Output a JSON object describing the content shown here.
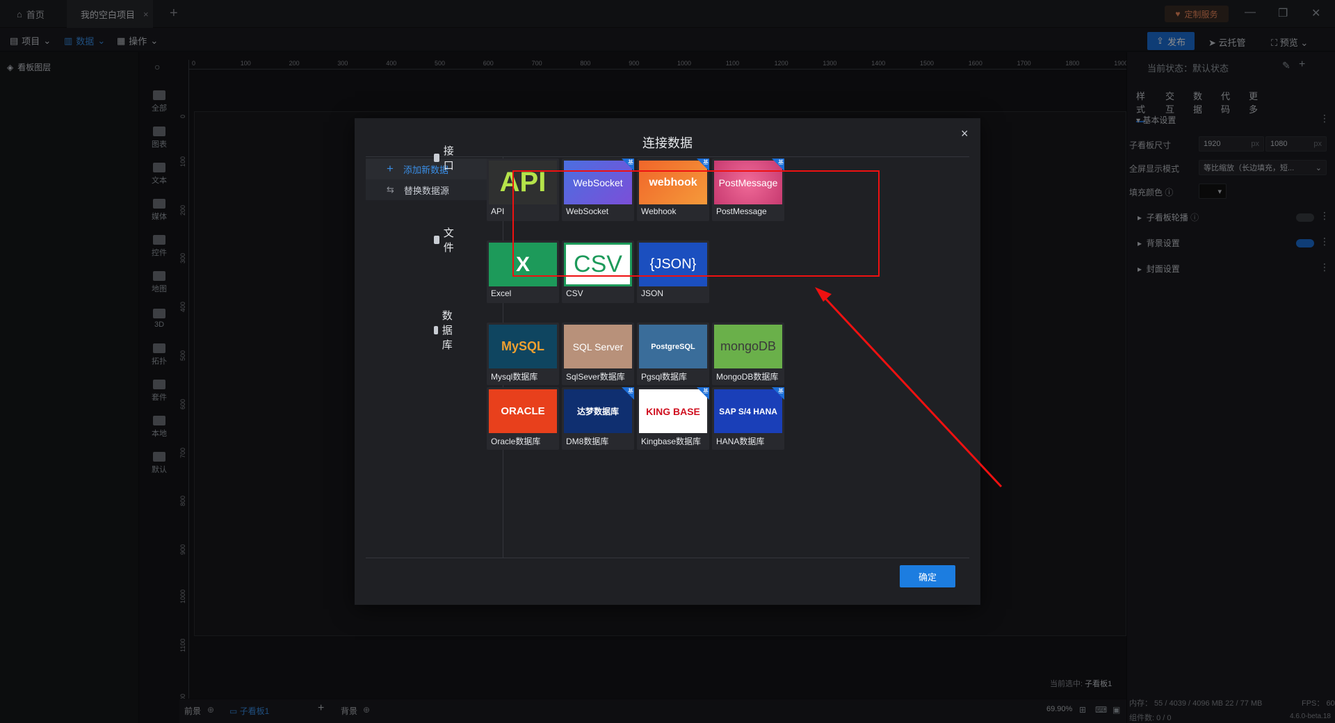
{
  "titlebar": {
    "home_tab": "首页",
    "project_tab": "我的空白项目",
    "close_tab": "×",
    "new_tab": "+",
    "custom_service": "定制服务"
  },
  "menubar": {
    "project": "项目",
    "data": "数据",
    "operation": "操作",
    "publish": "发布",
    "cloud": "云托管",
    "preview": "预览"
  },
  "left_panel": {
    "title": "看板图层",
    "tools": [
      "全部",
      "图表",
      "文本",
      "媒体",
      "控件",
      "地图",
      "3D",
      "拓扑",
      "套件",
      "本地",
      "默认"
    ]
  },
  "ruler": {
    "top": [
      "0",
      "100",
      "200",
      "300",
      "400",
      "500",
      "600",
      "700",
      "800",
      "900",
      "1000",
      "1100",
      "1200",
      "1300",
      "1400",
      "1500",
      "1600",
      "1700",
      "1800",
      "1900"
    ],
    "left": [
      "0",
      "100",
      "200",
      "300",
      "400",
      "500",
      "600",
      "700",
      "800",
      "900",
      "1000",
      "1100",
      "00"
    ]
  },
  "canvas": {
    "current_select_label": "当前选中:",
    "current_select_value": "子看板1"
  },
  "bottom": {
    "front": "前景",
    "board_tab": "子看板1",
    "back": "背景",
    "zoom": "69.90%",
    "memory": "内存： 55 / 4039 / 4096 MB  22 / 77 MB",
    "components": "组件数: 0 / 0",
    "fps": "FPS： 60",
    "version": "4.6.0-beta.18"
  },
  "right_panel": {
    "status": "当前状态：默认状态",
    "tabs": [
      "样式",
      "交互",
      "数据",
      "代码",
      "更多"
    ],
    "basic_settings": "基本设置",
    "board_size_label": "子看板尺寸",
    "width": "1920",
    "height": "1080",
    "unit": "px",
    "fullscreen_label": "全屏显示模式",
    "fullscreen_value": "等比缩放（长边填充，短...",
    "fill_color_label": "填充颜色",
    "carousel": "子看板轮播",
    "background": "背景设置",
    "cover": "封面设置"
  },
  "dialog": {
    "title": "连接数据",
    "close": "×",
    "side_add": "添加新数据",
    "side_replace": "替换数据源",
    "ok": "确定",
    "pro_badge": "基",
    "categories": [
      {
        "name": "接口",
        "items": [
          {
            "label": "API",
            "thumb": "API"
          },
          {
            "label": "WebSocket",
            "thumb": "WebSocket"
          },
          {
            "label": "Webhook",
            "thumb": "webhook"
          },
          {
            "label": "PostMessage",
            "thumb": "PostMessage"
          }
        ]
      },
      {
        "name": "文件",
        "items": [
          {
            "label": "Excel",
            "thumb": "X"
          },
          {
            "label": "CSV",
            "thumb": "CSV"
          },
          {
            "label": "JSON",
            "thumb": "{JSON}"
          }
        ]
      },
      {
        "name": "数据库",
        "items": [
          {
            "label": "Mysql数据库",
            "thumb": "MySQL"
          },
          {
            "label": "SqlSever数据库",
            "thumb": "SQL Server"
          },
          {
            "label": "Pgsql数据库",
            "thumb": "PostgreSQL"
          },
          {
            "label": "MongoDB数据库",
            "thumb": "mongoDB"
          },
          {
            "label": "Oracle数据库",
            "thumb": "ORACLE"
          },
          {
            "label": "DM8数据库",
            "thumb": "达梦数据库"
          },
          {
            "label": "Kingbase数据库",
            "thumb": "KING BASE"
          },
          {
            "label": "HANA数据库",
            "thumb": "SAP S/4 HANA"
          }
        ]
      }
    ]
  },
  "colors": {
    "accent": "#1c6fd8",
    "highlight_box": "#e11111",
    "arrow": "#e11111"
  }
}
